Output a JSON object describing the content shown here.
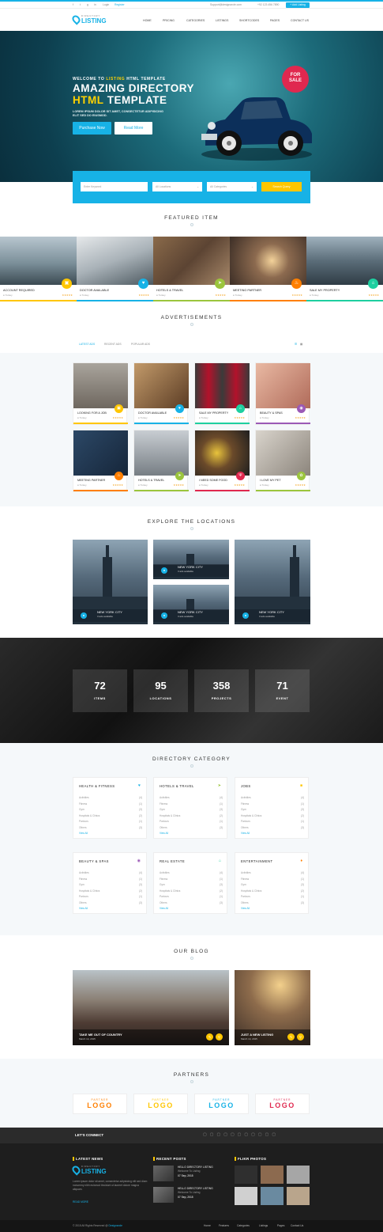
{
  "topbar": {
    "login": "Login",
    "register": "Register",
    "email": "Support@designarcle.com",
    "phone": "+92 123 456 7890",
    "add_listing": "Add Listing"
  },
  "nav": {
    "logo_tag": "DIRECTORY",
    "logo_text": "LISTING",
    "items": [
      "HOME",
      "PRICING",
      "CATEGORIES",
      "LISTINGS",
      "SHORTCODES",
      "PAGES",
      "CONTACT US"
    ]
  },
  "hero": {
    "pre_a": "WELCOME TO ",
    "pre_b": "LISTING",
    "pre_c": " HTML TEMPLATE",
    "title1": "AMAZING DIRECTORY",
    "title2a": "HTML",
    "title2b": " TEMPLATE",
    "sub": "LOREM IPSUM DOLOR SIT AMET, CONSECTETUR ADIPISICING ELIT SED DO EIUSMOD.",
    "btn_purchase": "Purchase Now",
    "btn_more": "Read More",
    "sale_a": "FOR",
    "sale_b": "SALE"
  },
  "search": {
    "keyword": "Enter Keyword",
    "location": "All Locations",
    "category": "All Categories",
    "button": "Search Query"
  },
  "featured": {
    "title": "FEATURED ITEM",
    "items": [
      {
        "title": "ACCOUNT REQUIRED",
        "loc": "Turkey",
        "color": "#ffc600",
        "icon": "briefcase-icon"
      },
      {
        "title": "DOCTOR AVAILABLE",
        "loc": "Turkey",
        "color": "#17b2e6",
        "icon": "heart-icon"
      },
      {
        "title": "HOTELS & TRAVEL",
        "loc": "Turkey",
        "color": "#9bc53d",
        "icon": "plane-icon"
      },
      {
        "title": "MEETING PARTNER",
        "loc": "Turkey",
        "color": "#ff7f00",
        "icon": "flame-icon"
      },
      {
        "title": "SALE MY PROPERTY",
        "loc": "Turkey",
        "color": "#1ecfa0",
        "icon": "home-icon"
      }
    ]
  },
  "ads": {
    "title": "ADVERTISEMENTS",
    "tabs": [
      "LATEST ADS",
      "RECENT ADS",
      "POPULAR ADS"
    ],
    "items": [
      {
        "title": "LOOKING FOR A JOB",
        "loc": "Turkey",
        "color": "#ffc600"
      },
      {
        "title": "DOCTOR AVAILABLE",
        "loc": "Turkey",
        "color": "#17b2e6"
      },
      {
        "title": "SALE MY PROPERTY",
        "loc": "Turkey",
        "color": "#1ecfa0"
      },
      {
        "title": "BEAUTY & SPAS",
        "loc": "Turkey",
        "color": "#9b59b6"
      },
      {
        "title": "MEETING PARTNER",
        "loc": "Turkey",
        "color": "#ff7f00"
      },
      {
        "title": "HOTELS & TRAVEL",
        "loc": "Turkey",
        "color": "#9bc53d"
      },
      {
        "title": "I NEED SOME FOOD",
        "loc": "Turkey",
        "color": "#e0284f"
      },
      {
        "title": "I LOVE MY PET",
        "loc": "Turkey",
        "color": "#9bc53d"
      }
    ]
  },
  "locations": {
    "title": "EXPLORE THE LOCATIONS",
    "items": [
      {
        "city": "NEW YORK CITY",
        "count": "3 ads available"
      },
      {
        "city": "NEW YORK CITY",
        "count": "3 ads available"
      },
      {
        "city": "NEW YORK CITY",
        "count": "3 ads available"
      },
      {
        "city": "NEW YORK CITY",
        "count": "3 ads available"
      }
    ]
  },
  "stats": [
    {
      "value": "72",
      "label": "ITEMS"
    },
    {
      "value": "95",
      "label": "LOCATIONS"
    },
    {
      "value": "358",
      "label": "PROJECTS"
    },
    {
      "value": "71",
      "label": "EVENT"
    }
  ],
  "directory": {
    "title": "DIRECTORY CATEGORY",
    "rows": [
      "Activities",
      "Fitness",
      "Gym",
      "Hospitals & Clinics",
      "Parlours",
      "Others"
    ],
    "view_all": "View All",
    "cats": [
      {
        "name": "HEALTH & FITNESS",
        "color": "#17b2e6",
        "icon": "♥",
        "counts": [
          "(4)",
          "(1)",
          "(3)",
          "(2)",
          "(1)",
          "(3)"
        ]
      },
      {
        "name": "HOTELS & TRAVEL",
        "color": "#9bc53d",
        "icon": "➤",
        "counts": [
          "(4)",
          "(1)",
          "(3)",
          "(2)",
          "(1)",
          "(3)"
        ]
      },
      {
        "name": "JOBS",
        "color": "#ffc600",
        "icon": "■",
        "counts": [
          "(4)",
          "(1)",
          "(3)",
          "(2)",
          "(1)",
          "(3)"
        ]
      },
      {
        "name": "BEAUTY & SPAS",
        "color": "#9b59b6",
        "icon": "◉",
        "counts": [
          "(4)",
          "(1)",
          "(3)",
          "(2)",
          "(1)",
          "(3)"
        ]
      },
      {
        "name": "REAL ESTATE",
        "color": "#1ecfa0",
        "icon": "⌂",
        "counts": [
          "(4)",
          "(1)",
          "(3)",
          "(2)",
          "(1)",
          "(3)"
        ]
      },
      {
        "name": "ENTERTAINMENT",
        "color": "#ff7f00",
        "icon": "♦",
        "counts": [
          "(4)",
          "(1)",
          "(3)",
          "(2)",
          "(1)",
          "(3)"
        ]
      }
    ]
  },
  "blog": {
    "title": "OUR BLOG",
    "posts": [
      {
        "title": "TAKE ME OUT OF COUNTRY",
        "date": "March 14, 2015"
      },
      {
        "title": "JUST A NEW LISTING",
        "date": "March 14, 2015"
      }
    ]
  },
  "partners": {
    "title": "PARTNERS",
    "items": [
      {
        "top": "PARTNER",
        "brand": "LOGO",
        "color": "#ff7f00"
      },
      {
        "top": "PARTNER",
        "brand": "LOGO",
        "color": "#ffc600"
      },
      {
        "top": "PARTNER",
        "brand": "LOGO",
        "color": "#17b2e6"
      },
      {
        "top": "PARTNER",
        "brand": "LOGO",
        "color": "#e0284f"
      }
    ]
  },
  "footer": {
    "connect": "LET'S CONNECT",
    "latest_news": "LATEST NEWS",
    "news_text": "Lorem ipsum dolor sit amet, consectetur adipisicing elit sed diam nonummy nibh euismod tincidunt ut laoreet dolore magna aliquam.",
    "read_more": "READ MORE",
    "recent_posts": "RECENT POSTS",
    "posts": [
      {
        "title": "HELLO DIRECTORY LISTING",
        "sub": "Welcome To Listing",
        "date": "07 Sep, 2015"
      },
      {
        "title": "HELLO DIRECTORY LISTING",
        "sub": "Welcome To Listing",
        "date": "07 Sep, 2015"
      }
    ],
    "flickr": "FLIKR PHOTOS",
    "copyright_a": "© 2015 All Rights Reserved @ ",
    "copyright_b": "Designarcle",
    "links": [
      "Home",
      "Features",
      "Categories",
      "Listings",
      "Pages",
      "Contact Us"
    ]
  }
}
